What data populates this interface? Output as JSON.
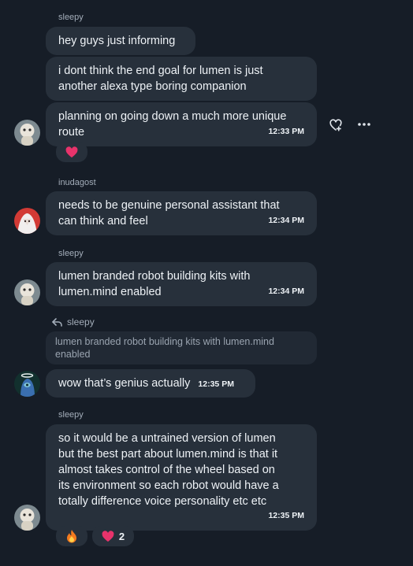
{
  "messages": {
    "g1": {
      "author": "sleepy",
      "m1": "hey guys just informing",
      "m2_line1": "i dont think the end goal for lumen is just",
      "m2_line2": "another alexa type boring companion",
      "m3_line1": "planning on going down a much more unique",
      "m3_line2": "route",
      "m3_time": "12:33 PM"
    },
    "g2": {
      "author": "inudagost",
      "line1": "needs to be genuine personal assistant that",
      "line2": "can think and feel",
      "time": "12:34 PM"
    },
    "g3": {
      "author": "sleepy",
      "line1": "lumen branded robot building kits with",
      "line2": "lumen.mind enabled",
      "time": "12:34 PM"
    },
    "g4": {
      "reply_to": "sleepy",
      "quote_line1": "lumen branded robot building kits with lumen.mind",
      "quote_line2": "enabled",
      "text": "wow that’s genius actually",
      "time": "12:35 PM"
    },
    "g5": {
      "author": "sleepy",
      "line1": "so it would be a untrained version of lumen",
      "line2": "but the best part about lumen.mind is that it",
      "line3": "almost takes control of the wheel based on",
      "line4": "its environment so each robot would have a",
      "line5": "totally difference voice personality etc etc",
      "time": "12:35 PM",
      "reaction2_count": "2"
    }
  },
  "colors": {
    "background": "#161d27",
    "bubble": "#27303b",
    "heart": "#e8336b",
    "fire": "#f47a1e"
  },
  "icons": [
    "heart-plus-icon",
    "more-icon",
    "reply-arrow-icon",
    "heart-icon",
    "fire-icon"
  ]
}
